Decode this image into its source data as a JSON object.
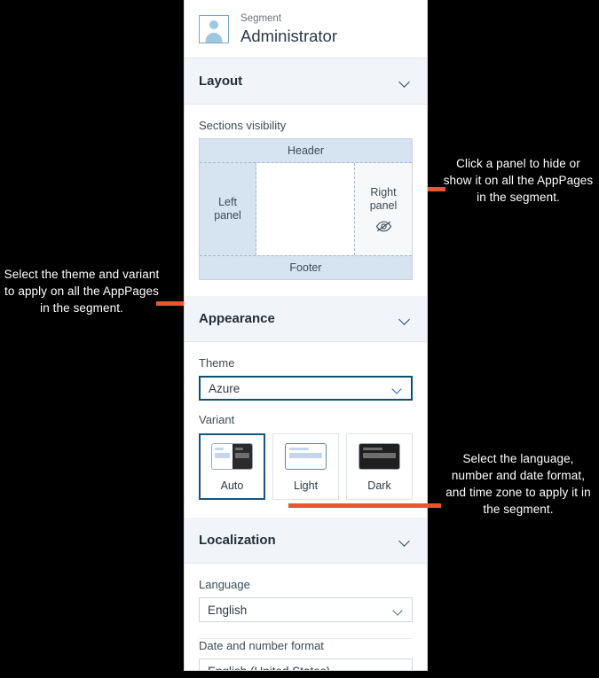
{
  "segment": {
    "label": "Segment",
    "name": "Administrator",
    "avatar_icon": "user-avatar-icon"
  },
  "sections": [
    {
      "id": "layout",
      "title": "Layout",
      "chevron_icon": "chevron-down-icon"
    },
    {
      "id": "appearance",
      "title": "Appearance",
      "chevron_icon": "chevron-down-icon"
    },
    {
      "id": "localization",
      "title": "Localization",
      "chevron_icon": "chevron-down-icon"
    }
  ],
  "layout": {
    "sections_visibility_label": "Sections visibility",
    "regions": {
      "header": "Header",
      "footer": "Footer",
      "left_panel": "Left\npanel",
      "left_panel_line1": "Left",
      "left_panel_line2": "panel",
      "right_panel_line1": "Right",
      "right_panel_line2": "panel"
    },
    "right_panel_state_icon": "eye-slash-icon",
    "colors": {
      "visible_region": "#d6e3f0",
      "hidden_region": "#f7f8f9",
      "region_border": "#c8d3dd"
    }
  },
  "appearance": {
    "theme_label": "Theme",
    "theme_value": "Azure",
    "theme_focus_color": "#0b5272",
    "variant_label": "Variant",
    "variants": [
      {
        "name": "Auto",
        "selected": true,
        "thumb": "split-light-dark-thumb"
      },
      {
        "name": "Light",
        "selected": false,
        "thumb": "light-thumb"
      },
      {
        "name": "Dark",
        "selected": false,
        "thumb": "dark-thumb"
      }
    ]
  },
  "localization": {
    "language_label": "Language",
    "language_value": "English",
    "date_format_label": "Date and number format",
    "date_format_value": "English (United States)"
  },
  "annotations": {
    "sections_visibility": "Click a panel to hide or show it on all the AppPages in the segment.",
    "appearance": "Select the theme and variant to apply on all the AppPages in the segment.",
    "localization": "Select the language, number and date format, and time zone to apply it in the segment.",
    "connector_color": "#e8562a"
  }
}
